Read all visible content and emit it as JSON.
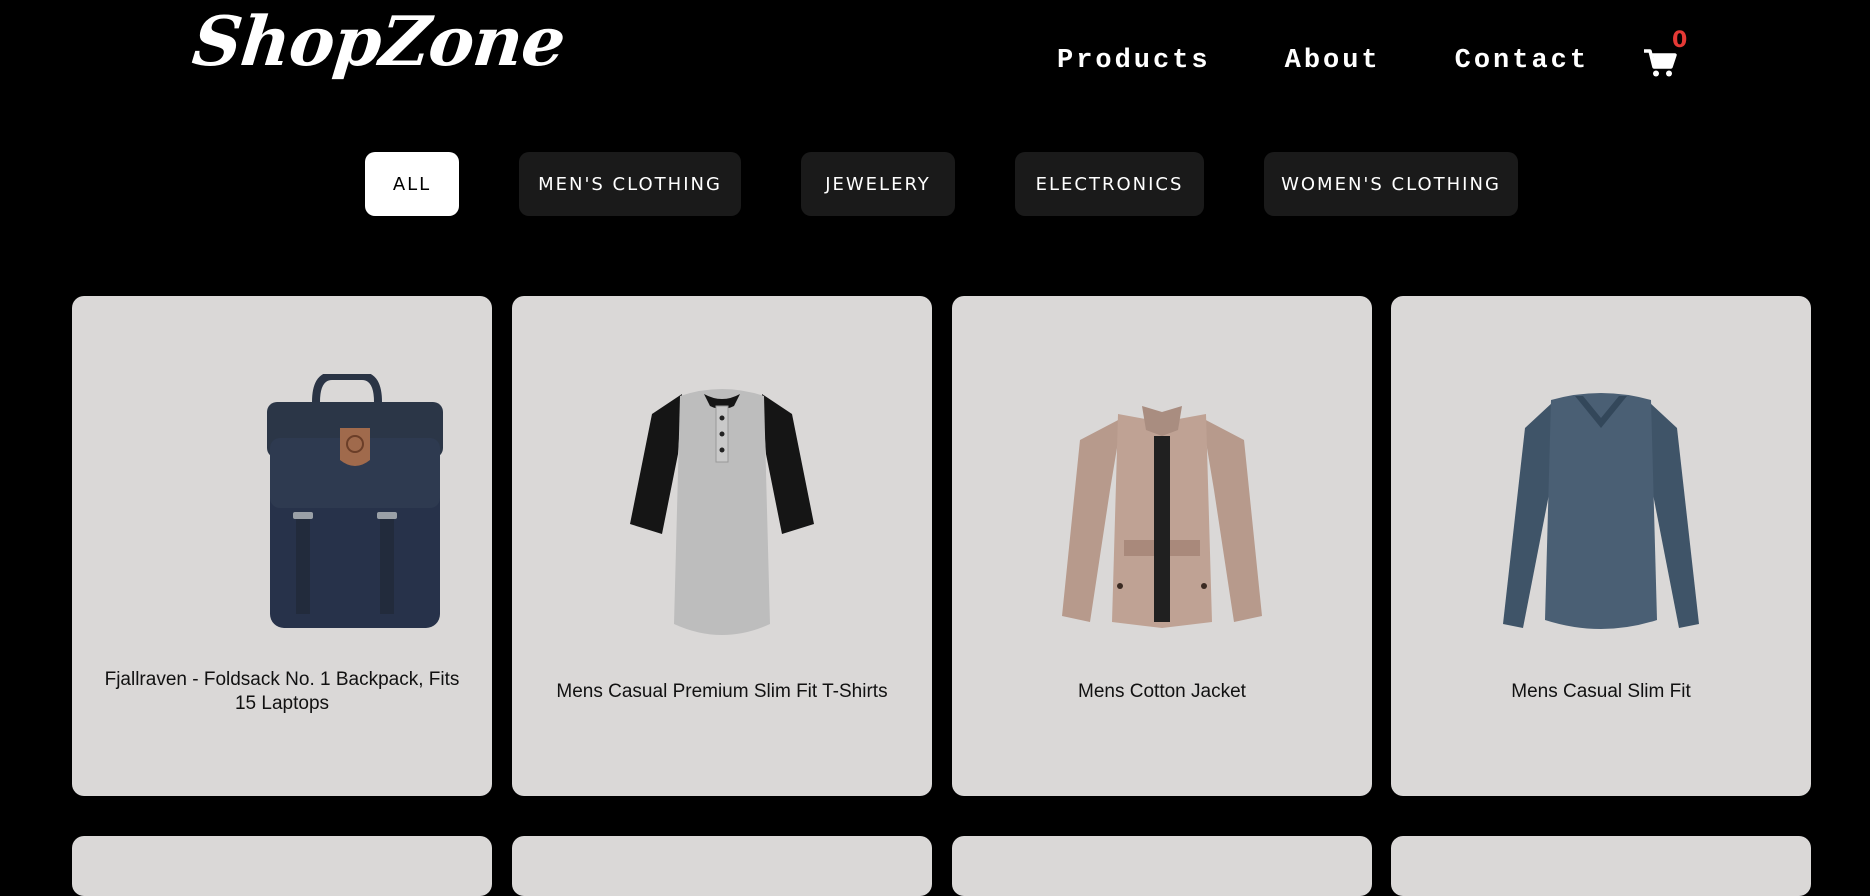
{
  "header": {
    "logo": "ShopZone",
    "nav": [
      "Products",
      "About",
      "Contact"
    ],
    "cart_icon": "cart-icon",
    "cart_count": "0"
  },
  "filters": [
    {
      "label": "ALL",
      "active": true
    },
    {
      "label": "MEN'S CLOTHING",
      "active": false
    },
    {
      "label": "JEWELERY",
      "active": false
    },
    {
      "label": "ELECTRONICS",
      "active": false
    },
    {
      "label": "WOMEN'S CLOTHING",
      "active": false
    }
  ],
  "products": [
    {
      "title": "Fjallraven - Foldsack No. 1 Backpack, Fits 15 Laptops",
      "image": "backpack-image"
    },
    {
      "title": "Mens Casual Premium Slim Fit T-Shirts",
      "image": "raglan-tshirt-image"
    },
    {
      "title": "Mens Cotton Jacket",
      "image": "cotton-jacket-image"
    },
    {
      "title": "Mens Casual Slim Fit",
      "image": "longsleeve-shirt-image"
    }
  ],
  "colors": {
    "background": "#000000",
    "card": "#dad8d7",
    "filter_bg": "#1a1a1a",
    "badge": "#e53935"
  }
}
